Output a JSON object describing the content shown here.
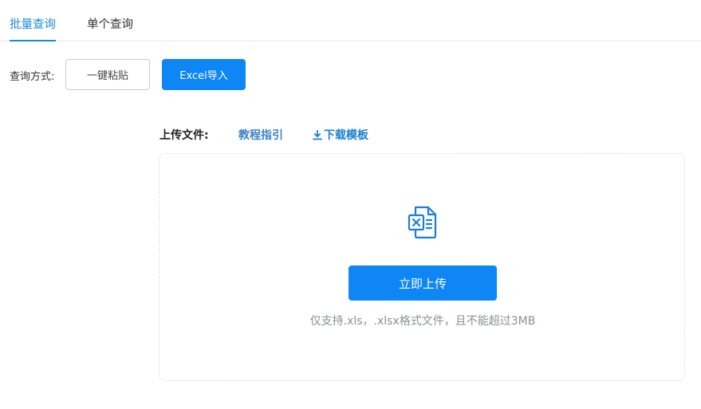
{
  "tabs": {
    "batch_label": "批量查询",
    "single_label": "单个查询"
  },
  "query_mode": {
    "label": "查询方式:",
    "paste_label": "一键粘贴",
    "excel_label": "Excel导入"
  },
  "upload": {
    "label": "上传文件:",
    "guide_link": "教程指引",
    "download_link": "下载模板",
    "button_label": "立即上传",
    "hint": "仅支持.xls，.xlsx格式文件，且不能超过3MB"
  },
  "colors": {
    "accent": "#0e86f5",
    "active_tab": "#1a8ae0",
    "link": "#3d84c6"
  },
  "icons": {
    "download": "download-icon",
    "file": "excel-file-icon"
  }
}
